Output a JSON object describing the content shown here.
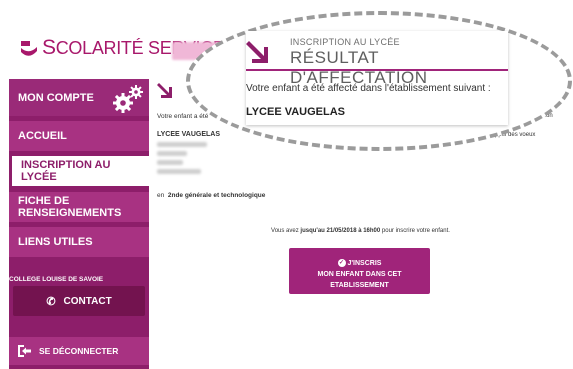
{
  "brand": {
    "title_prefix": "S",
    "title_rest": "COLARITÉ SERVICES",
    "accent": "#a8186b"
  },
  "sidebar": {
    "account_label": "MON COMPTE",
    "items": [
      {
        "label": "ACCUEIL"
      },
      {
        "label": "INSCRIPTION AU LYCÉE"
      },
      {
        "label": "FICHE DE RENSEIGNEMENTS"
      },
      {
        "label": "LIENS UTILES"
      }
    ],
    "college_label": "COLLEGE LOUISE DE SAVOIE",
    "contact_label": "CONTACT",
    "logout_label": "SE DÉCONNECTER"
  },
  "popup": {
    "subtitle": "INSCRIPTION AU LYCÉE",
    "title": "RÉSULTAT D'AFFECTATION",
    "message": "Votre enfant a été affecté dans l'établissement suivant :",
    "school": "LYCEE VAUGELAS"
  },
  "main": {
    "intro_fragment": "Votre enfant a été",
    "intro_end_fragment": "tation",
    "school_name": "LYCEE VAUGELAS",
    "voeux_fragment": "appel des voeux",
    "level_prefix": "en",
    "level": "2nde générale et technologique",
    "deadline_prefix": "Vous avez",
    "deadline_date": "jusqu'au 21/05/2018 à 16h00",
    "deadline_suffix": "pour inscrire votre enfant.",
    "cta_line1": "J'INSCRIS",
    "cta_line2": "MON ENFANT DANS CET ETABLISSEMENT"
  }
}
